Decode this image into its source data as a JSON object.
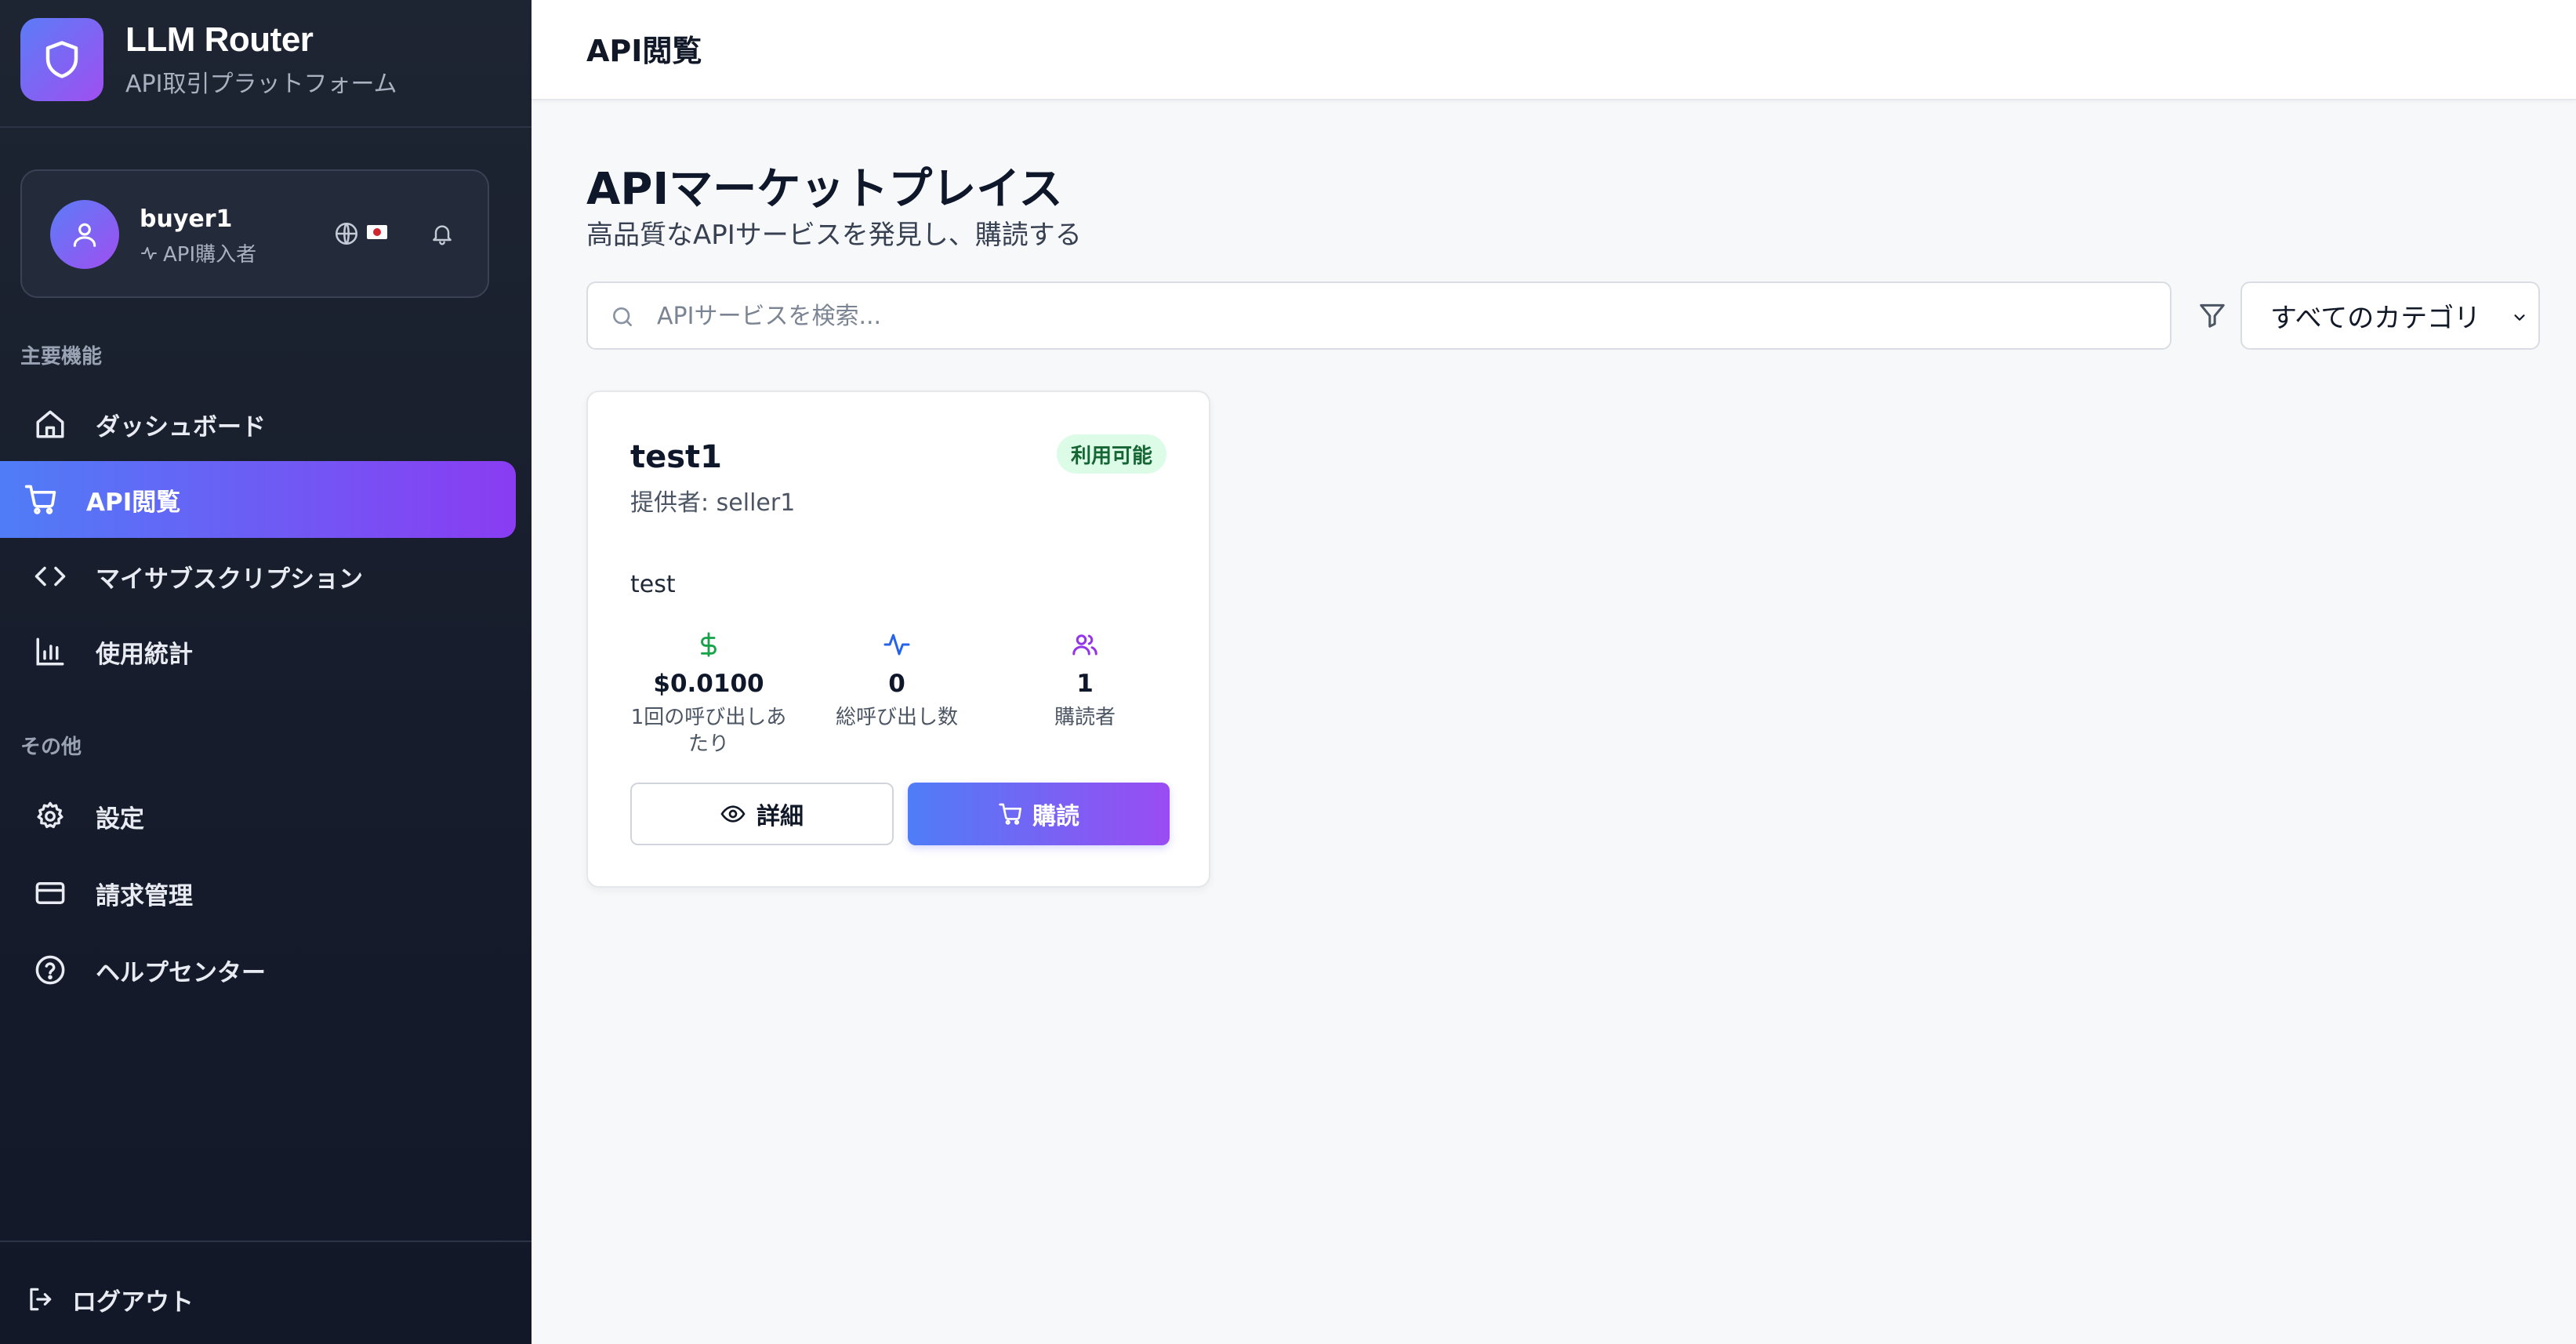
{
  "brand": {
    "title": "LLM Router",
    "subtitle": "API取引プラットフォーム"
  },
  "user": {
    "name": "buyer1",
    "role": "API購入者"
  },
  "sidebar": {
    "section_main": "主要機能",
    "section_other": "その他",
    "items": [
      {
        "label": "ダッシュボード",
        "icon": "home-icon"
      },
      {
        "label": "API閲覧",
        "icon": "cart-icon",
        "active": true
      },
      {
        "label": "マイサブスクリプション",
        "icon": "code-icon"
      },
      {
        "label": "使用統計",
        "icon": "bar-chart-icon"
      }
    ],
    "other_items": [
      {
        "label": "設定",
        "icon": "gear-icon"
      },
      {
        "label": "請求管理",
        "icon": "credit-card-icon"
      },
      {
        "label": "ヘルプセンター",
        "icon": "help-circle-icon"
      }
    ],
    "logout": "ログアウト"
  },
  "topbar": {
    "title": "API閲覧"
  },
  "main": {
    "title": "APIマーケットプレイス",
    "subtitle": "高品質なAPIサービスを発見し、購読する",
    "search_placeholder": "APIサービスを検索...",
    "search_value": "",
    "category_selected": "すべてのカテゴリ"
  },
  "card": {
    "title": "test1",
    "provider": "提供者: seller1",
    "badge": "利用可能",
    "description": "test",
    "stats": [
      {
        "value": "$0.0100",
        "label": "1回の呼び出しあたり",
        "icon": "dollar-icon"
      },
      {
        "value": "0",
        "label": "総呼び出し数",
        "icon": "activity-icon"
      },
      {
        "value": "1",
        "label": "購読者",
        "icon": "users-icon"
      }
    ],
    "detail_button": "詳細",
    "subscribe_button": "購読"
  },
  "colors": {
    "accent_start": "#4f7df7",
    "accent_end": "#8a3cf2",
    "badge_bg": "#dcfce7",
    "badge_text": "#166534",
    "sidebar_bg": "#1e2532"
  }
}
